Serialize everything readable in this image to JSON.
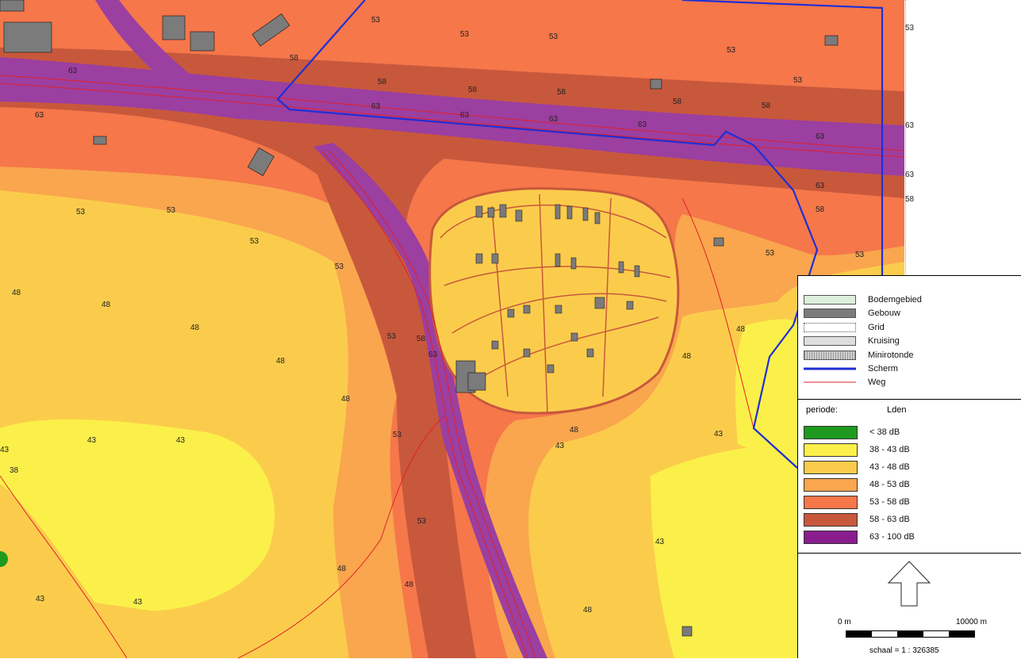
{
  "map": {
    "colors": {
      "lt38": "#1f9a1f",
      "z38_43": "#fbf04a",
      "z43_48": "#fbcc4c",
      "z48_53": "#f9a64e",
      "z53_58": "#f5774a",
      "z58_63": "#c8583c",
      "z63_100": "#9b3fa0",
      "buildings": "#7b7b7b",
      "road": "#e0202a",
      "screen": "#1f2fd6"
    },
    "labels": {
      "l63": "63",
      "l58": "58",
      "l53": "53",
      "l48": "48",
      "l43": "43",
      "l38": "38"
    },
    "edge_labels": [
      "53",
      "63",
      "63",
      "58"
    ]
  },
  "legend": {
    "layers": [
      {
        "label": "Bodemgebied",
        "fill": "#dcefdc",
        "kind": "box"
      },
      {
        "label": "Gebouw",
        "fill": "#7b7b7b",
        "kind": "box"
      },
      {
        "label": "Grid",
        "fill": "#ffffff",
        "kind": "grid"
      },
      {
        "label": "Kruising",
        "fill": "#dedede",
        "kind": "box"
      },
      {
        "label": "Minirotonde",
        "fill": "#cfcfcf",
        "kind": "dots"
      },
      {
        "label": "Scherm",
        "color": "#1f2fd6",
        "kind": "line"
      },
      {
        "label": "Weg",
        "color": "#e0202a",
        "kind": "thinline"
      }
    ],
    "periode_label": "periode:",
    "periode_value": "Lden",
    "noise_classes": [
      {
        "label": "< 38 dB",
        "color": "#1f9a1f"
      },
      {
        "label": "38 - 43 dB",
        "color": "#fbf04a"
      },
      {
        "label": "43 - 48 dB",
        "color": "#fbcc4c"
      },
      {
        "label": "48 - 53 dB",
        "color": "#f9a64e"
      },
      {
        "label": "53 - 58 dB",
        "color": "#f5774a"
      },
      {
        "label": "58 - 63 dB",
        "color": "#c8583c"
      },
      {
        "label": "63 - 100 dB",
        "color": "#8a1d8e"
      }
    ],
    "scale": {
      "start": "0 m",
      "end": "10000 m",
      "ratio": "schaal = 1 : 326385"
    }
  }
}
